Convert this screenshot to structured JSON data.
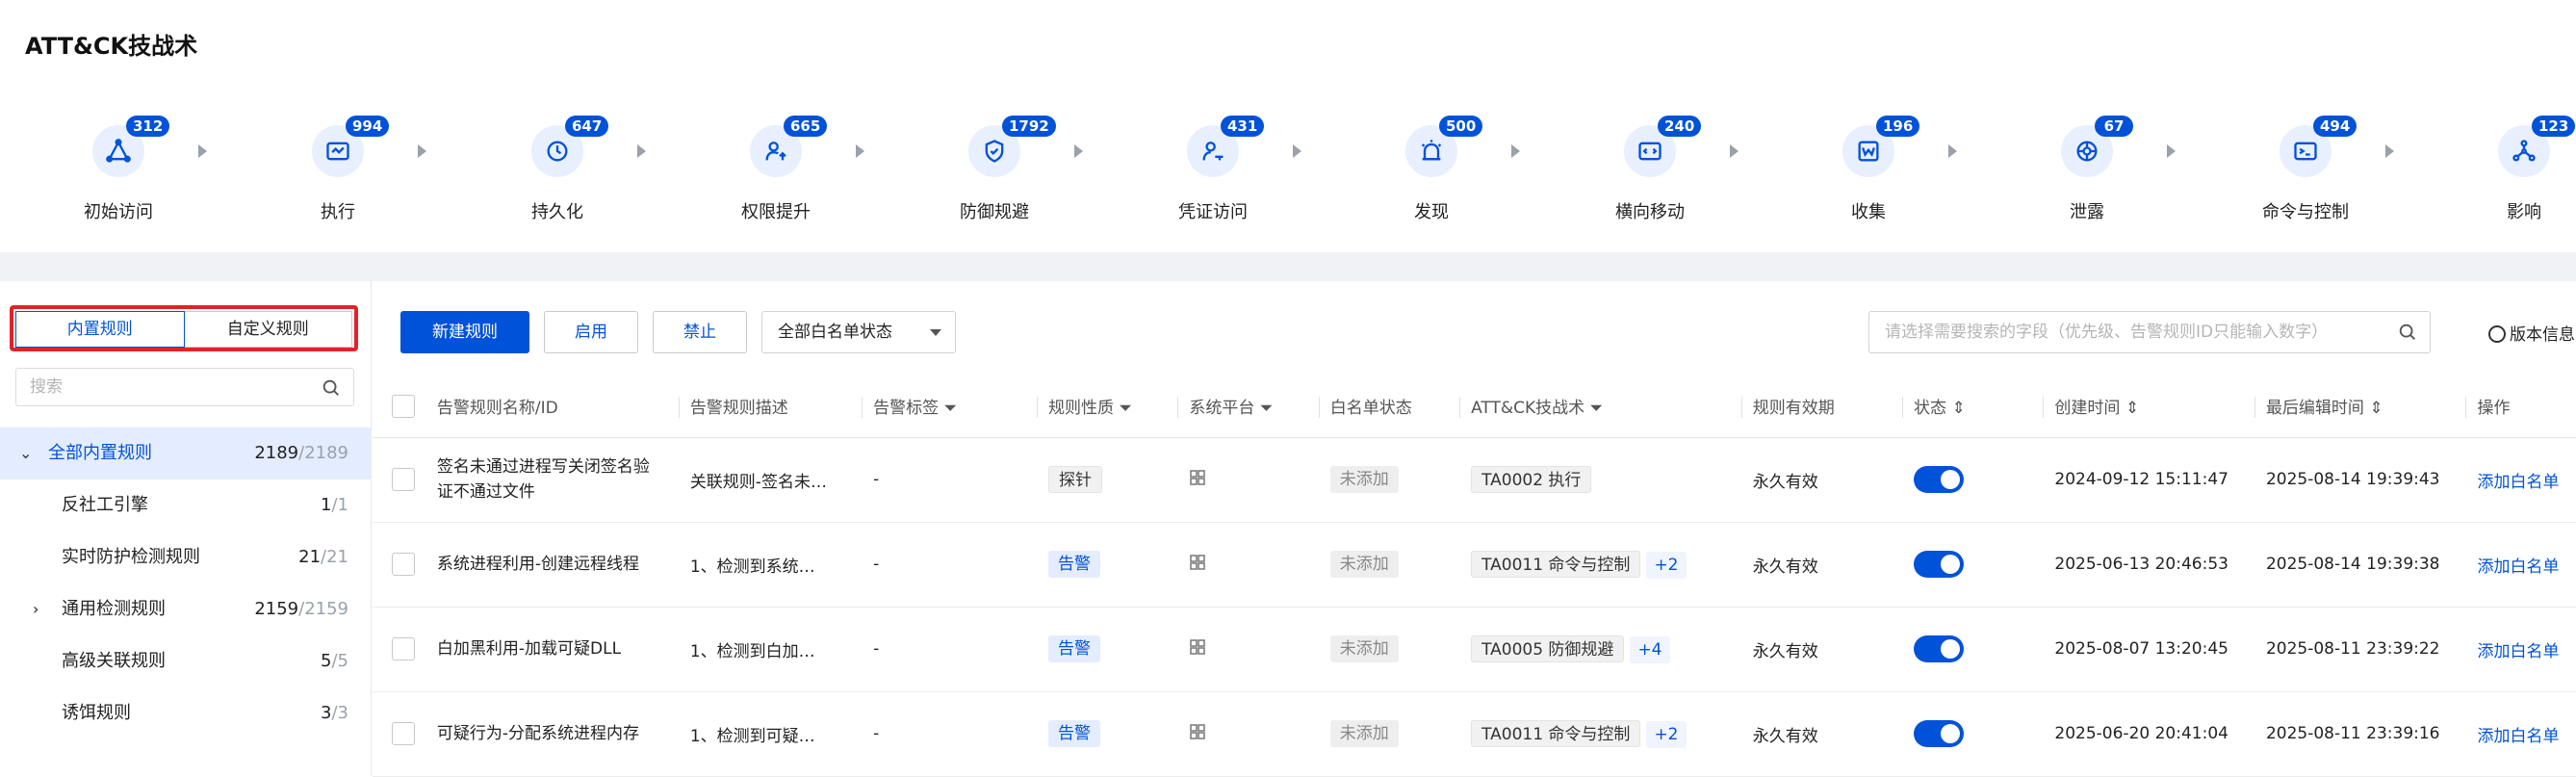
{
  "page": {
    "title": "ATT&CK技战术"
  },
  "tactics": [
    {
      "name": "初始访问",
      "count": "312",
      "icon": "triangle-network-icon"
    },
    {
      "name": "执行",
      "count": "994",
      "icon": "terminal-window-icon"
    },
    {
      "name": "持久化",
      "count": "647",
      "icon": "clock-icon"
    },
    {
      "name": "权限提升",
      "count": "665",
      "icon": "user-up-icon"
    },
    {
      "name": "防御规避",
      "count": "1792",
      "icon": "shield-icon"
    },
    {
      "name": "凭证访问",
      "count": "431",
      "icon": "user-key-icon"
    },
    {
      "name": "发现",
      "count": "500",
      "icon": "alarm-icon"
    },
    {
      "name": "横向移动",
      "count": "240",
      "icon": "code-window-icon"
    },
    {
      "name": "收集",
      "count": "196",
      "icon": "document-w-icon"
    },
    {
      "name": "泄露",
      "count": "67",
      "icon": "aperture-icon"
    },
    {
      "name": "命令与控制",
      "count": "494",
      "icon": "console-icon"
    },
    {
      "name": "影响",
      "count": "123",
      "icon": "network-nodes-icon"
    }
  ],
  "sidebar": {
    "tabs": {
      "builtin": "内置规则",
      "custom": "自定义规则"
    },
    "search_placeholder": "搜索",
    "tree": {
      "root": {
        "label": "全部内置规则",
        "count": "2189",
        "total": "/2189"
      },
      "items": [
        {
          "label": "反社工引擎",
          "count": "1",
          "total": "/1"
        },
        {
          "label": "实时防护检测规则",
          "count": "21",
          "total": "/21"
        },
        {
          "label": "通用检测规则",
          "count": "2159",
          "total": "/2159"
        },
        {
          "label": "高级关联规则",
          "count": "5",
          "total": "/5"
        },
        {
          "label": "诱饵规则",
          "count": "3",
          "total": "/3"
        }
      ]
    }
  },
  "toolbar": {
    "new_rule": "新建规则",
    "enable": "启用",
    "disable": "禁止",
    "whitelist_filter": "全部白名单状态",
    "search_placeholder": "请选择需要搜索的字段（优先级、告警规则ID只能输入数字）",
    "version_info": "版本信息"
  },
  "table": {
    "headers": {
      "name": "告警规则名称/ID",
      "desc": "告警规则描述",
      "tag": "告警标签",
      "nature": "规则性质",
      "platform": "系统平台",
      "whitelist": "白名单状态",
      "attck": "ATT&CK技战术",
      "validity": "规则有效期",
      "status": "状态",
      "created": "创建时间",
      "edited": "最后编辑时间",
      "action": "操作"
    },
    "rows": [
      {
        "name": "签名未通过进程写关闭签名验证不通过文件",
        "desc": "关联规则-签名未…",
        "tag": "-",
        "nature": "探针",
        "whitelist": "未添加",
        "attck": "TA0002 执行",
        "more": "",
        "validity": "永久有效",
        "created": "2024-09-12 15:11:47",
        "edited": "2025-08-14 19:39:43",
        "action": "添加白名单"
      },
      {
        "name": "系统进程利用-创建远程线程",
        "desc": "1、检测到系统…",
        "tag": "-",
        "nature": "告警",
        "whitelist": "未添加",
        "attck": "TA0011 命令与控制",
        "more": "+2",
        "validity": "永久有效",
        "created": "2025-06-13 20:46:53",
        "edited": "2025-08-14 19:39:38",
        "action": "添加白名单"
      },
      {
        "name": "白加黑利用-加载可疑DLL",
        "desc": "1、检测到白加…",
        "tag": "-",
        "nature": "告警",
        "whitelist": "未添加",
        "attck": "TA0005 防御规避",
        "more": "+4",
        "validity": "永久有效",
        "created": "2025-08-07 13:20:45",
        "edited": "2025-08-11 23:39:22",
        "action": "添加白名单"
      },
      {
        "name": "可疑行为-分配系统进程内存",
        "desc": "1、检测到可疑…",
        "tag": "-",
        "nature": "告警",
        "whitelist": "未添加",
        "attck": "TA0011 命令与控制",
        "more": "+2",
        "validity": "永久有效",
        "created": "2025-06-20 20:41:04",
        "edited": "2025-08-11 23:39:16",
        "action": "添加白名单"
      }
    ]
  },
  "colors": {
    "primary": "#0052d9",
    "highlight_border": "#e3212b",
    "band": "#f0f2f6"
  }
}
